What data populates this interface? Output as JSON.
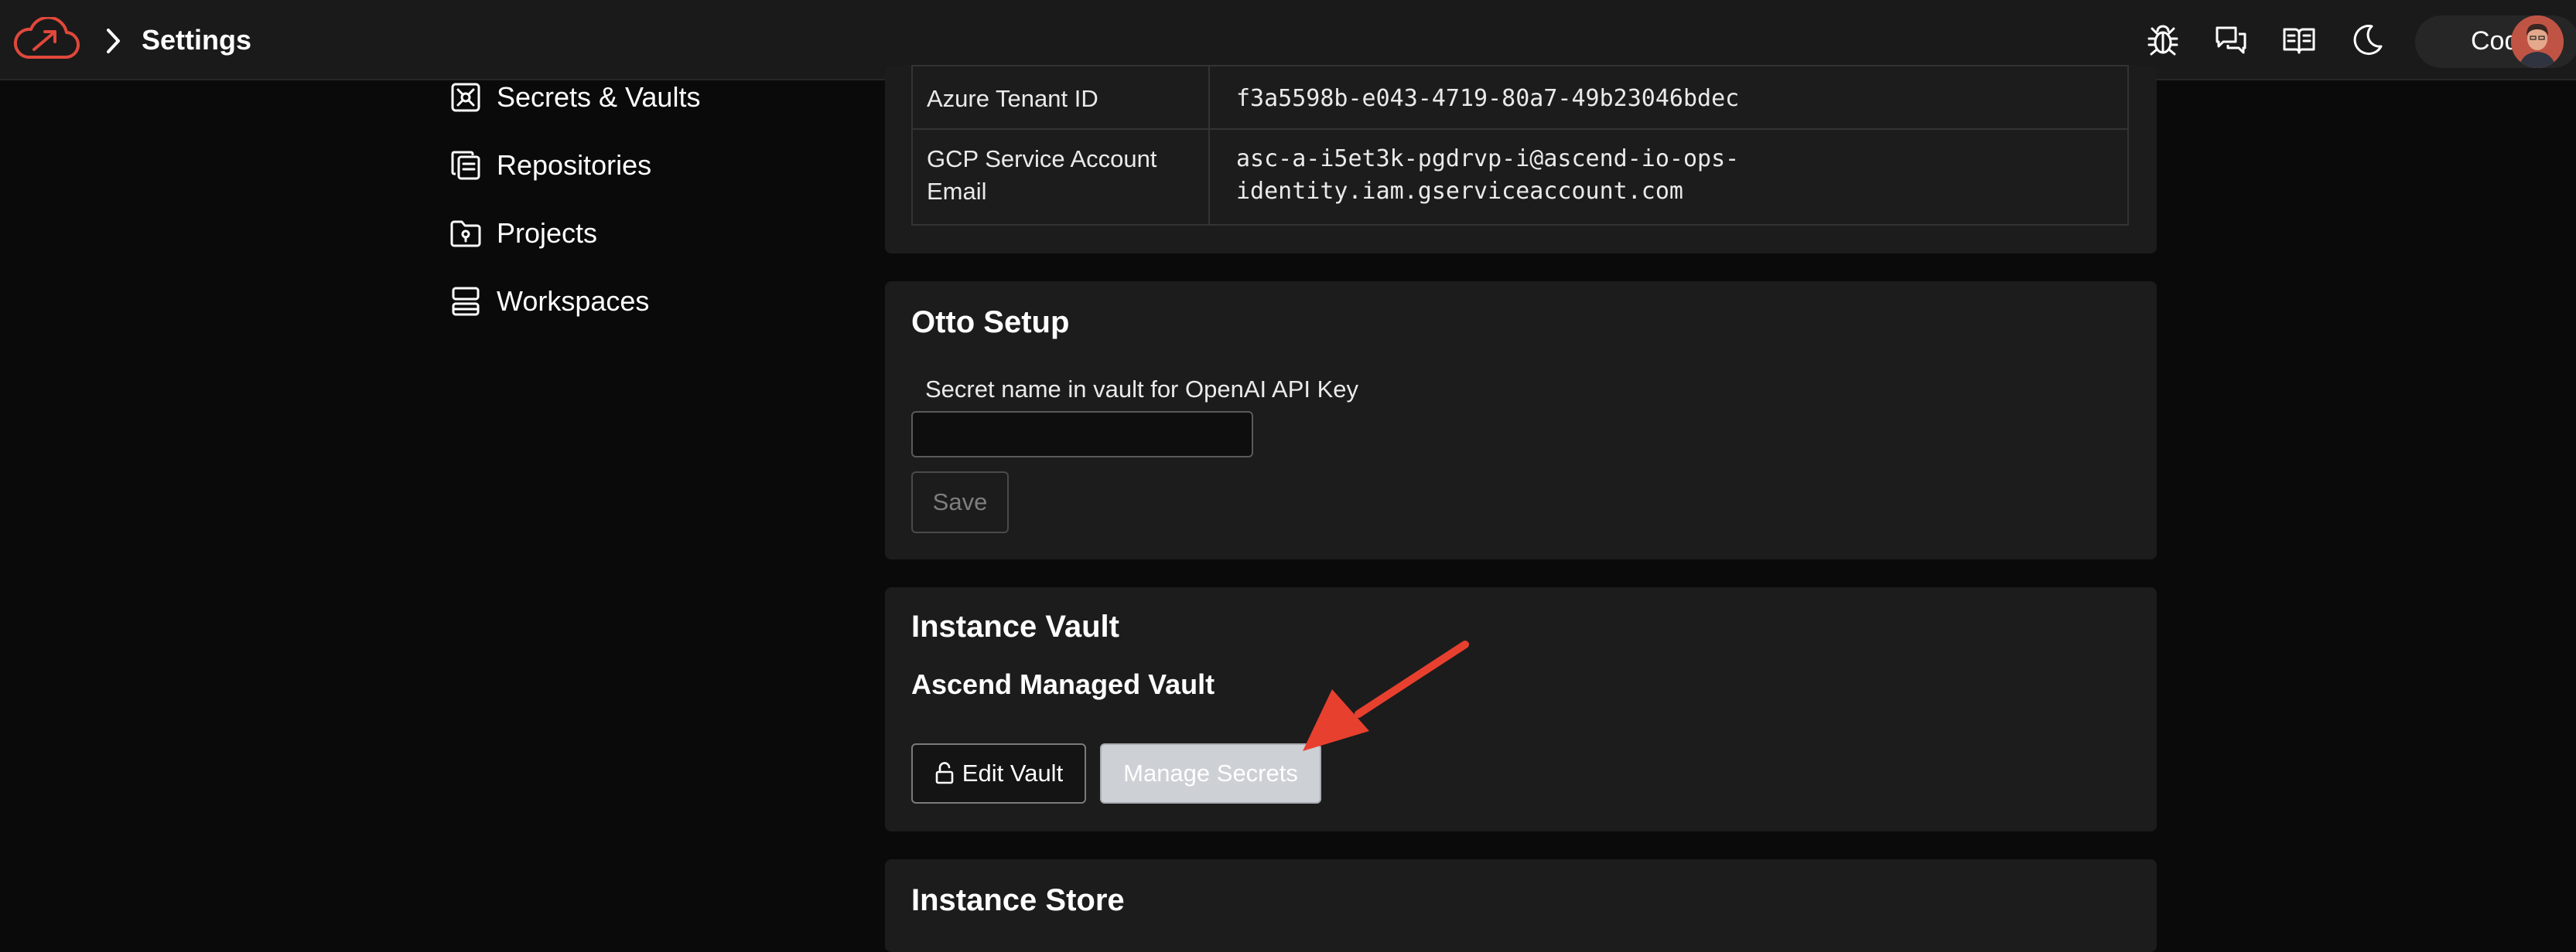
{
  "header": {
    "title": "Settings",
    "user_name": "Cody",
    "icons": [
      "bug-icon",
      "chat-bubbles-icon",
      "book-icon",
      "moon-icon"
    ]
  },
  "sidebar": {
    "items": [
      {
        "label": "Secrets & Vaults",
        "icon": "vault-icon"
      },
      {
        "label": "Repositories",
        "icon": "repositories-icon"
      },
      {
        "label": "Projects",
        "icon": "folder-icon"
      },
      {
        "label": "Workspaces",
        "icon": "workspaces-icon"
      }
    ]
  },
  "identity_table": {
    "rows": [
      {
        "key": "Azure Tenant ID",
        "value": "f3a5598b-e043-4719-80a7-49b23046bdec"
      },
      {
        "key_line1": "GCP Service Account",
        "key_line2": "Email",
        "value_line1": "asc-a-i5et3k-pgdrvp-i@ascend-io-ops-",
        "value_line2": "identity.iam.gserviceaccount.com"
      }
    ]
  },
  "otto_setup": {
    "title": "Otto Setup",
    "field_label": "Secret name in vault for OpenAI API Key",
    "field_value": "",
    "save_label": "Save"
  },
  "instance_vault": {
    "title": "Instance Vault",
    "subtitle": "Ascend Managed Vault",
    "edit_label": "Edit Vault",
    "manage_label": "Manage Secrets"
  },
  "instance_store": {
    "title": "Instance Store"
  },
  "colors": {
    "brand": "#e0483b",
    "annotation_arrow": "#e8402f",
    "manage_button_bg": "#cdd0d5"
  }
}
